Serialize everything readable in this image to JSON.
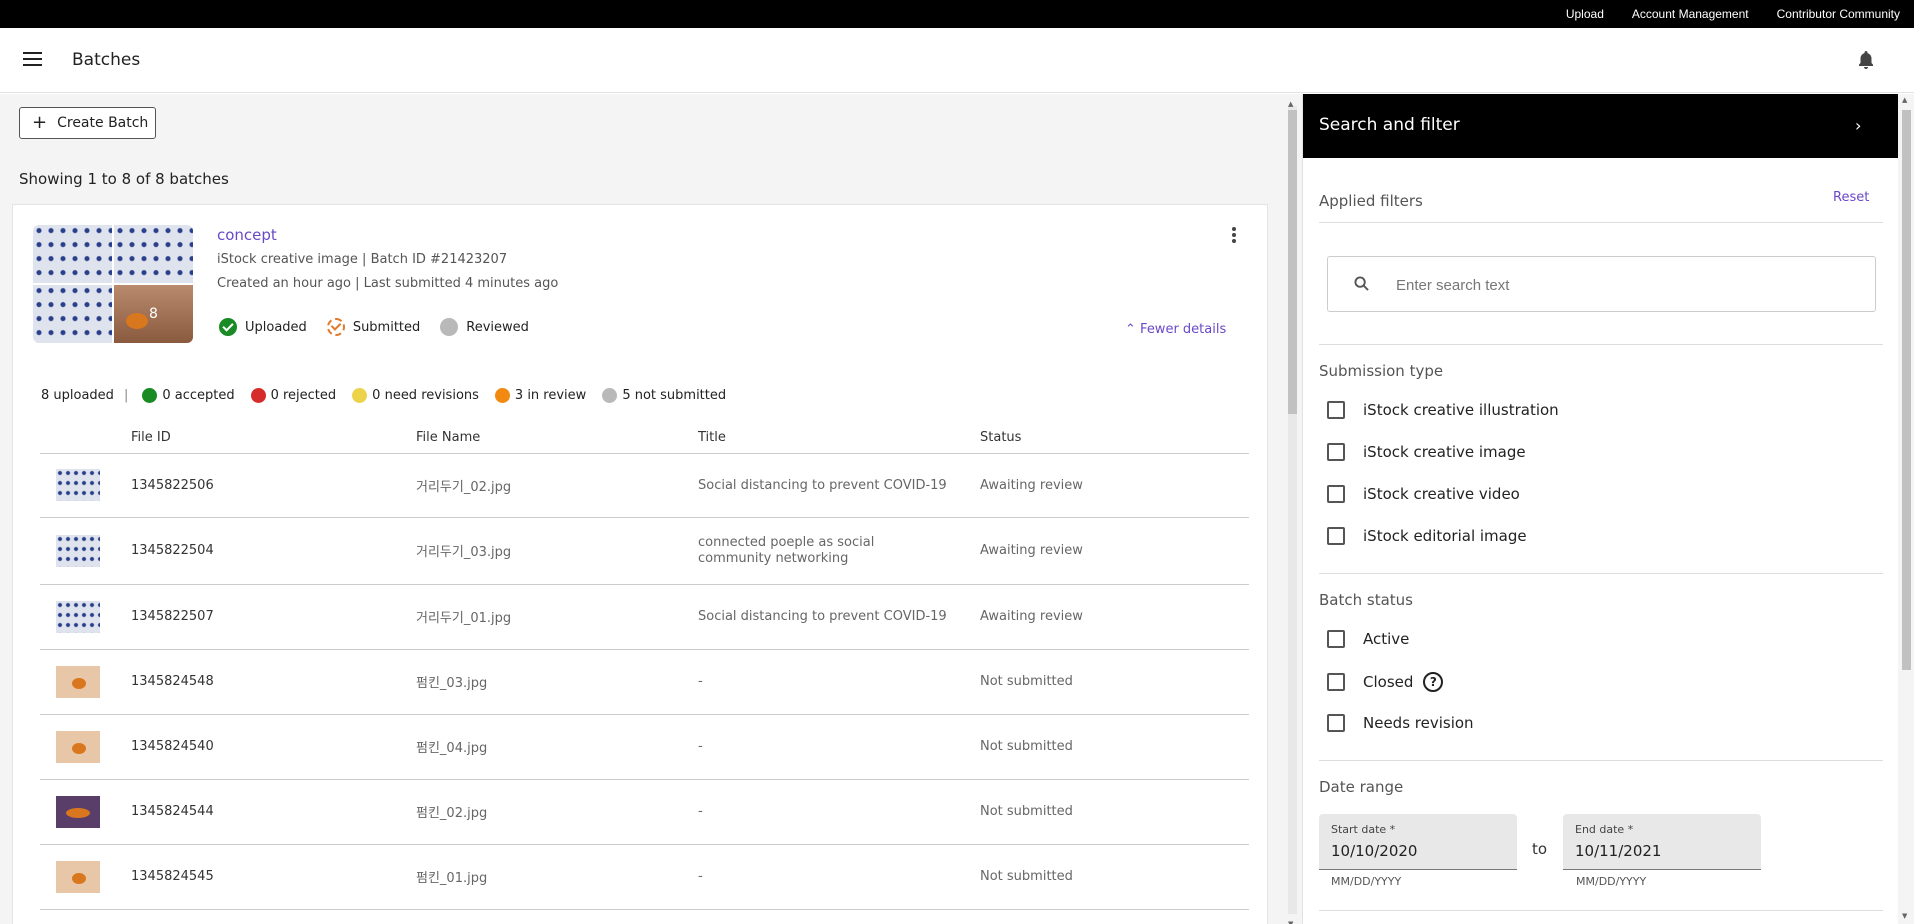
{
  "topbar": {
    "links": [
      "Upload",
      "Account Management",
      "Contributor Community"
    ]
  },
  "header": {
    "title": "Batches"
  },
  "toolbar": {
    "create_batch_label": "Create Batch",
    "showing_text": "Showing 1 to 8 of 8 batches"
  },
  "batch": {
    "name": "concept",
    "meta": "iStock creative image | Batch ID #21423207",
    "dates": "Created an hour ago | Last submitted 4 minutes ago",
    "thumb_count": "8",
    "steps": [
      "Uploaded",
      "Submitted",
      "Reviewed"
    ],
    "fewer_details": "Fewer details",
    "summary": {
      "uploaded": "8 uploaded",
      "separator": "|",
      "items": [
        {
          "label": "0 accepted",
          "color": "#1a8a24"
        },
        {
          "label": "0 rejected",
          "color": "#d62b2b"
        },
        {
          "label": "0 need revisions",
          "color": "#ecd34a"
        },
        {
          "label": "3 in review",
          "color": "#f28a12"
        },
        {
          "label": "5 not submitted",
          "color": "#b9b9b9"
        }
      ]
    },
    "table": {
      "headers": [
        "File ID",
        "File Name",
        "Title",
        "Status"
      ],
      "rows": [
        {
          "id": "1345822506",
          "name": "거리두기_02.jpg",
          "title": "Social distancing to prevent COVID-19",
          "status": "Awaiting review",
          "thumb": "people"
        },
        {
          "id": "1345822504",
          "name": "거리두기_03.jpg",
          "title": "connected poeple as social community networking",
          "status": "Awaiting review",
          "thumb": "people"
        },
        {
          "id": "1345822507",
          "name": "거리두기_01.jpg",
          "title": "Social distancing to prevent COVID-19",
          "status": "Awaiting review",
          "thumb": "people"
        },
        {
          "id": "1345824548",
          "name": "펌킨_03.jpg",
          "title": "-",
          "status": "Not submitted",
          "thumb": "pumpkin"
        },
        {
          "id": "1345824540",
          "name": "펌킨_04.jpg",
          "title": "-",
          "status": "Not submitted",
          "thumb": "pumpkin"
        },
        {
          "id": "1345824544",
          "name": "펌킨_02.jpg",
          "title": "-",
          "status": "Not submitted",
          "thumb": "dark"
        },
        {
          "id": "1345824545",
          "name": "펌킨_01.jpg",
          "title": "-",
          "status": "Not submitted",
          "thumb": "pumpkin"
        }
      ]
    }
  },
  "panel": {
    "title": "Search and filter",
    "applied_filters": "Applied filters",
    "reset": "Reset",
    "search_placeholder": "Enter search text",
    "submission_type": {
      "title": "Submission type",
      "options": [
        "iStock creative illustration",
        "iStock creative image",
        "iStock creative video",
        "iStock editorial image"
      ]
    },
    "batch_status": {
      "title": "Batch status",
      "options": [
        "Active",
        "Closed",
        "Needs revision"
      ]
    },
    "date_range": {
      "title": "Date range",
      "start_label": "Start date *",
      "start_value": "10/10/2020",
      "end_label": "End date *",
      "end_value": "10/11/2021",
      "to": "to",
      "hint": "MM/DD/YYYY"
    }
  },
  "colors": {
    "accent": "#6b48c8",
    "topbar": "#000000"
  }
}
